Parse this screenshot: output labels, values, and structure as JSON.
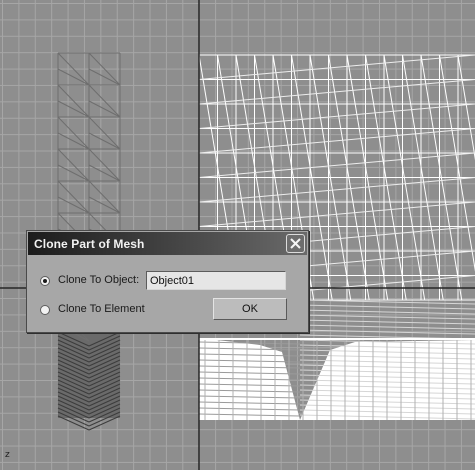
{
  "dialog": {
    "title": "Clone Part of Mesh",
    "options": [
      {
        "label": "Clone To Object:",
        "selected": true
      },
      {
        "label": "Clone To Element",
        "selected": false
      }
    ],
    "object_name_value": "Object01",
    "ok_label": "OK"
  },
  "viewport": {
    "axis_label": "z"
  },
  "colors": {
    "viewport_bg": "#8e8e8e",
    "grid_line": "#a6a6a6",
    "axis_line": "#262626",
    "mesh_wire": "#ffffff",
    "dialog_bg": "#a7a7a7",
    "titlebar": "#2a2a2a"
  }
}
